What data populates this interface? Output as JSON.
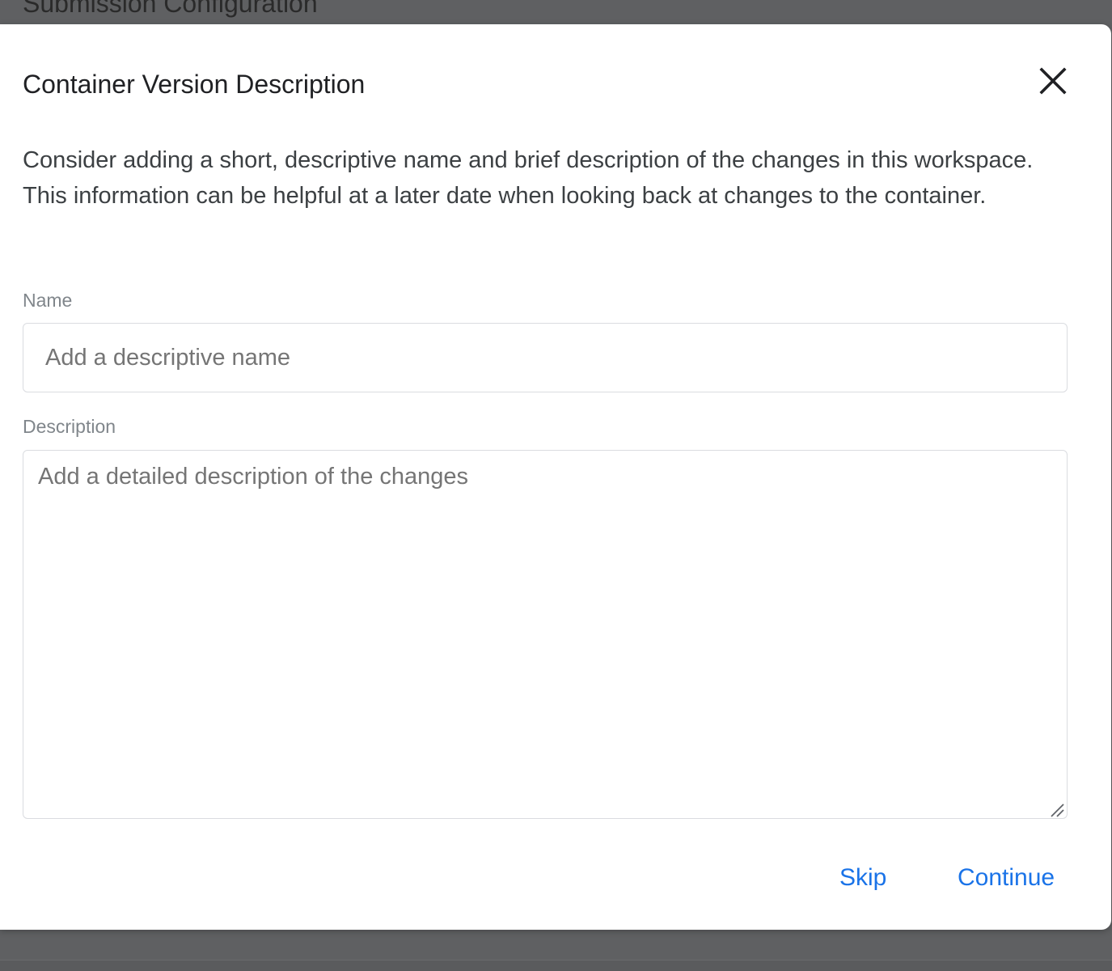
{
  "background": {
    "title": "Submission Configuration"
  },
  "dialog": {
    "title": "Container Version Description",
    "close_icon": "close-icon",
    "intro": "Consider adding a short, descriptive name and brief description of the changes in this workspace. This information can be helpful at a later date when looking back at changes to the container.",
    "name_field": {
      "label": "Name",
      "value": "",
      "placeholder": "Add a descriptive name"
    },
    "description_field": {
      "label": "Description",
      "value": "",
      "placeholder": "Add a detailed description of the changes"
    },
    "buttons": {
      "skip": "Skip",
      "continue": "Continue"
    }
  },
  "colors": {
    "accent": "#1a73e8",
    "overlay": "#5f6062",
    "text": "#202124"
  }
}
